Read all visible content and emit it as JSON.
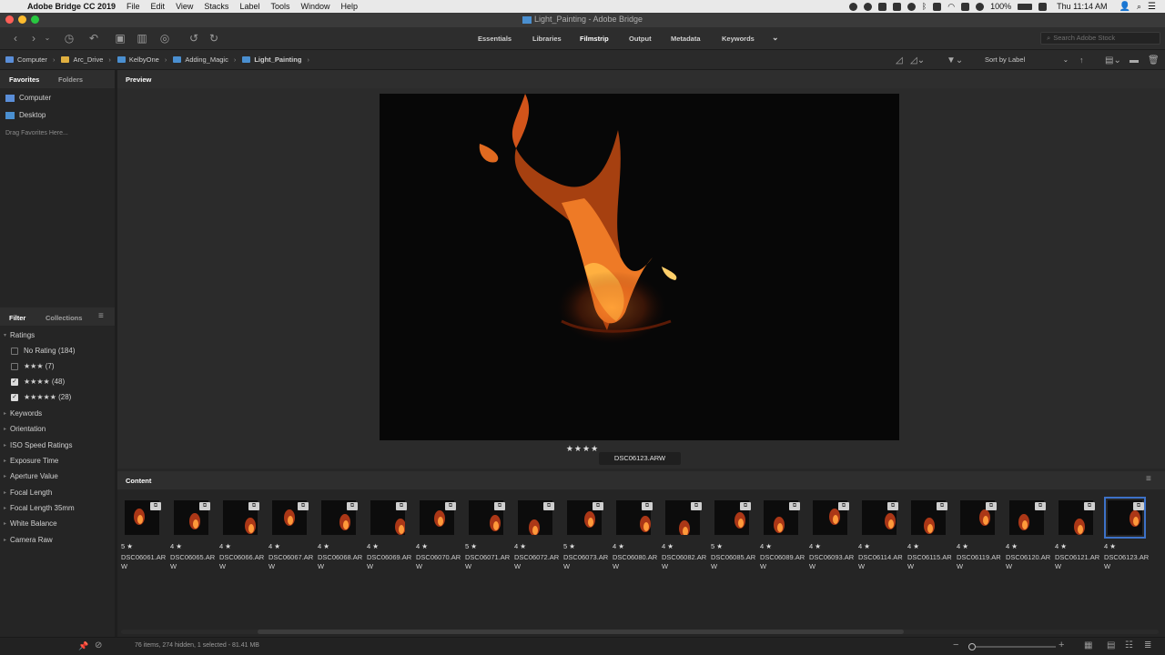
{
  "menubar": {
    "app_name": "Adobe Bridge CC 2019",
    "items": [
      "File",
      "Edit",
      "View",
      "Stacks",
      "Label",
      "Tools",
      "Window",
      "Help"
    ],
    "battery": "100%",
    "clock": "Thu 11:14 AM"
  },
  "window": {
    "title": "Light_Painting - Adobe Bridge"
  },
  "workspaces": [
    "Essentials",
    "Libraries",
    "Filmstrip",
    "Output",
    "Metadata",
    "Keywords"
  ],
  "active_workspace": "Filmstrip",
  "search": {
    "placeholder": "Search Adobe Stock"
  },
  "path": [
    "Computer",
    "Arc_Drive",
    "KelbyOne",
    "Adding_Magic",
    "Light_Painting"
  ],
  "sort": {
    "label": "Sort by Label"
  },
  "favorites_panel": {
    "tabs": [
      "Favorites",
      "Folders"
    ],
    "items": [
      "Computer",
      "Desktop"
    ],
    "drag_hint": "Drag Favorites Here..."
  },
  "filter_panel": {
    "tabs": [
      "Filter",
      "Collections"
    ],
    "ratings_label": "Ratings",
    "ratings": [
      {
        "label": "No Rating",
        "stars": "",
        "count": "(184)",
        "checked": false
      },
      {
        "label": "",
        "stars": "★★★",
        "count": "(7)",
        "checked": false
      },
      {
        "label": "",
        "stars": "★★★★",
        "count": "(48)",
        "checked": true
      },
      {
        "label": "",
        "stars": "★★★★★",
        "count": "(28)",
        "checked": true
      }
    ],
    "categories": [
      "Keywords",
      "Orientation",
      "ISO Speed Ratings",
      "Exposure Time",
      "Aperture Value",
      "Focal Length",
      "Focal Length 35mm",
      "White Balance",
      "Camera Raw"
    ]
  },
  "preview": {
    "tab": "Preview",
    "stars": "★★★★",
    "filename": "DSC06123.ARW"
  },
  "content": {
    "tab": "Content",
    "thumbs": [
      {
        "stars": "5 ★",
        "name": "DSC06061.ARW"
      },
      {
        "stars": "4 ★",
        "name": "DSC06065.ARW"
      },
      {
        "stars": "4 ★",
        "name": "DSC06066.ARW"
      },
      {
        "stars": "4 ★",
        "name": "DSC06067.ARW"
      },
      {
        "stars": "4 ★",
        "name": "DSC06068.ARW"
      },
      {
        "stars": "4 ★",
        "name": "DSC06069.ARW"
      },
      {
        "stars": "4 ★",
        "name": "DSC06070.ARW"
      },
      {
        "stars": "5 ★",
        "name": "DSC06071.ARW"
      },
      {
        "stars": "4 ★",
        "name": "DSC06072.ARW"
      },
      {
        "stars": "5 ★",
        "name": "DSC06073.ARW"
      },
      {
        "stars": "4 ★",
        "name": "DSC06080.ARW"
      },
      {
        "stars": "4 ★",
        "name": "DSC06082.ARW"
      },
      {
        "stars": "5 ★",
        "name": "DSC06085.ARW"
      },
      {
        "stars": "4 ★",
        "name": "DSC06089.ARW"
      },
      {
        "stars": "4 ★",
        "name": "DSC06093.ARW"
      },
      {
        "stars": "4 ★",
        "name": "DSC06114.ARW"
      },
      {
        "stars": "4 ★",
        "name": "DSC06115.ARW"
      },
      {
        "stars": "4 ★",
        "name": "DSC06119.ARW"
      },
      {
        "stars": "4 ★",
        "name": "DSC06120.ARW"
      },
      {
        "stars": "4 ★",
        "name": "DSC06121.ARW"
      },
      {
        "stars": "4 ★",
        "name": "DSC06123.ARW"
      }
    ],
    "selected_index": 20
  },
  "status": {
    "text": "76 items, 274 hidden, 1 selected - 81.41 MB"
  },
  "colors": {
    "accent": "#3d72c8",
    "folder": "#4a8fd0",
    "panel": "#252525"
  }
}
